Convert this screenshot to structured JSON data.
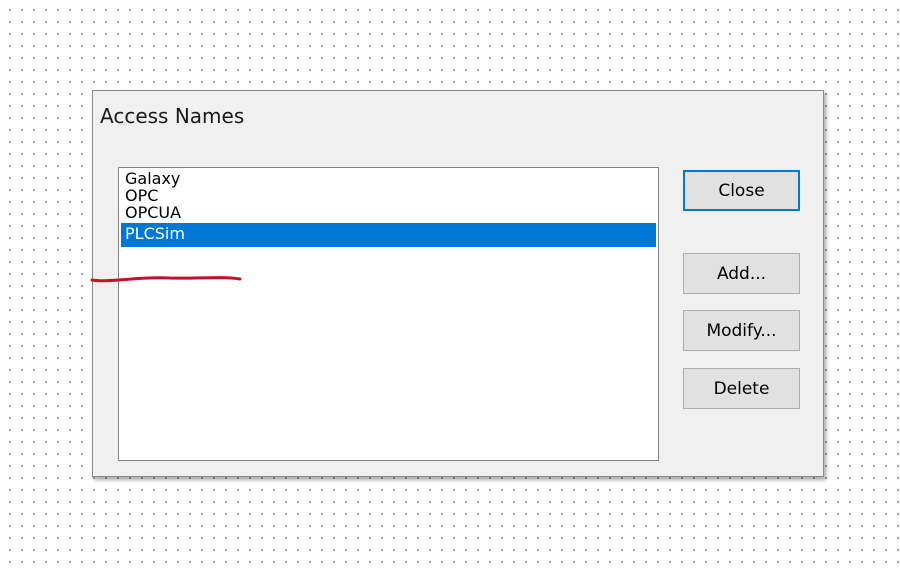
{
  "dialog": {
    "title": "Access Names"
  },
  "listbox": {
    "items": [
      {
        "label": "Galaxy",
        "selected": false
      },
      {
        "label": "OPC",
        "selected": false
      },
      {
        "label": "OPCUA",
        "selected": false
      },
      {
        "label": "PLCSim",
        "selected": true
      }
    ]
  },
  "buttons": {
    "close_label": "Close",
    "add_label": "Add...",
    "modify_label": "Modify...",
    "delete_label": "Delete"
  },
  "colors": {
    "selection": "#0078d7",
    "annotation": "#c8102e"
  }
}
